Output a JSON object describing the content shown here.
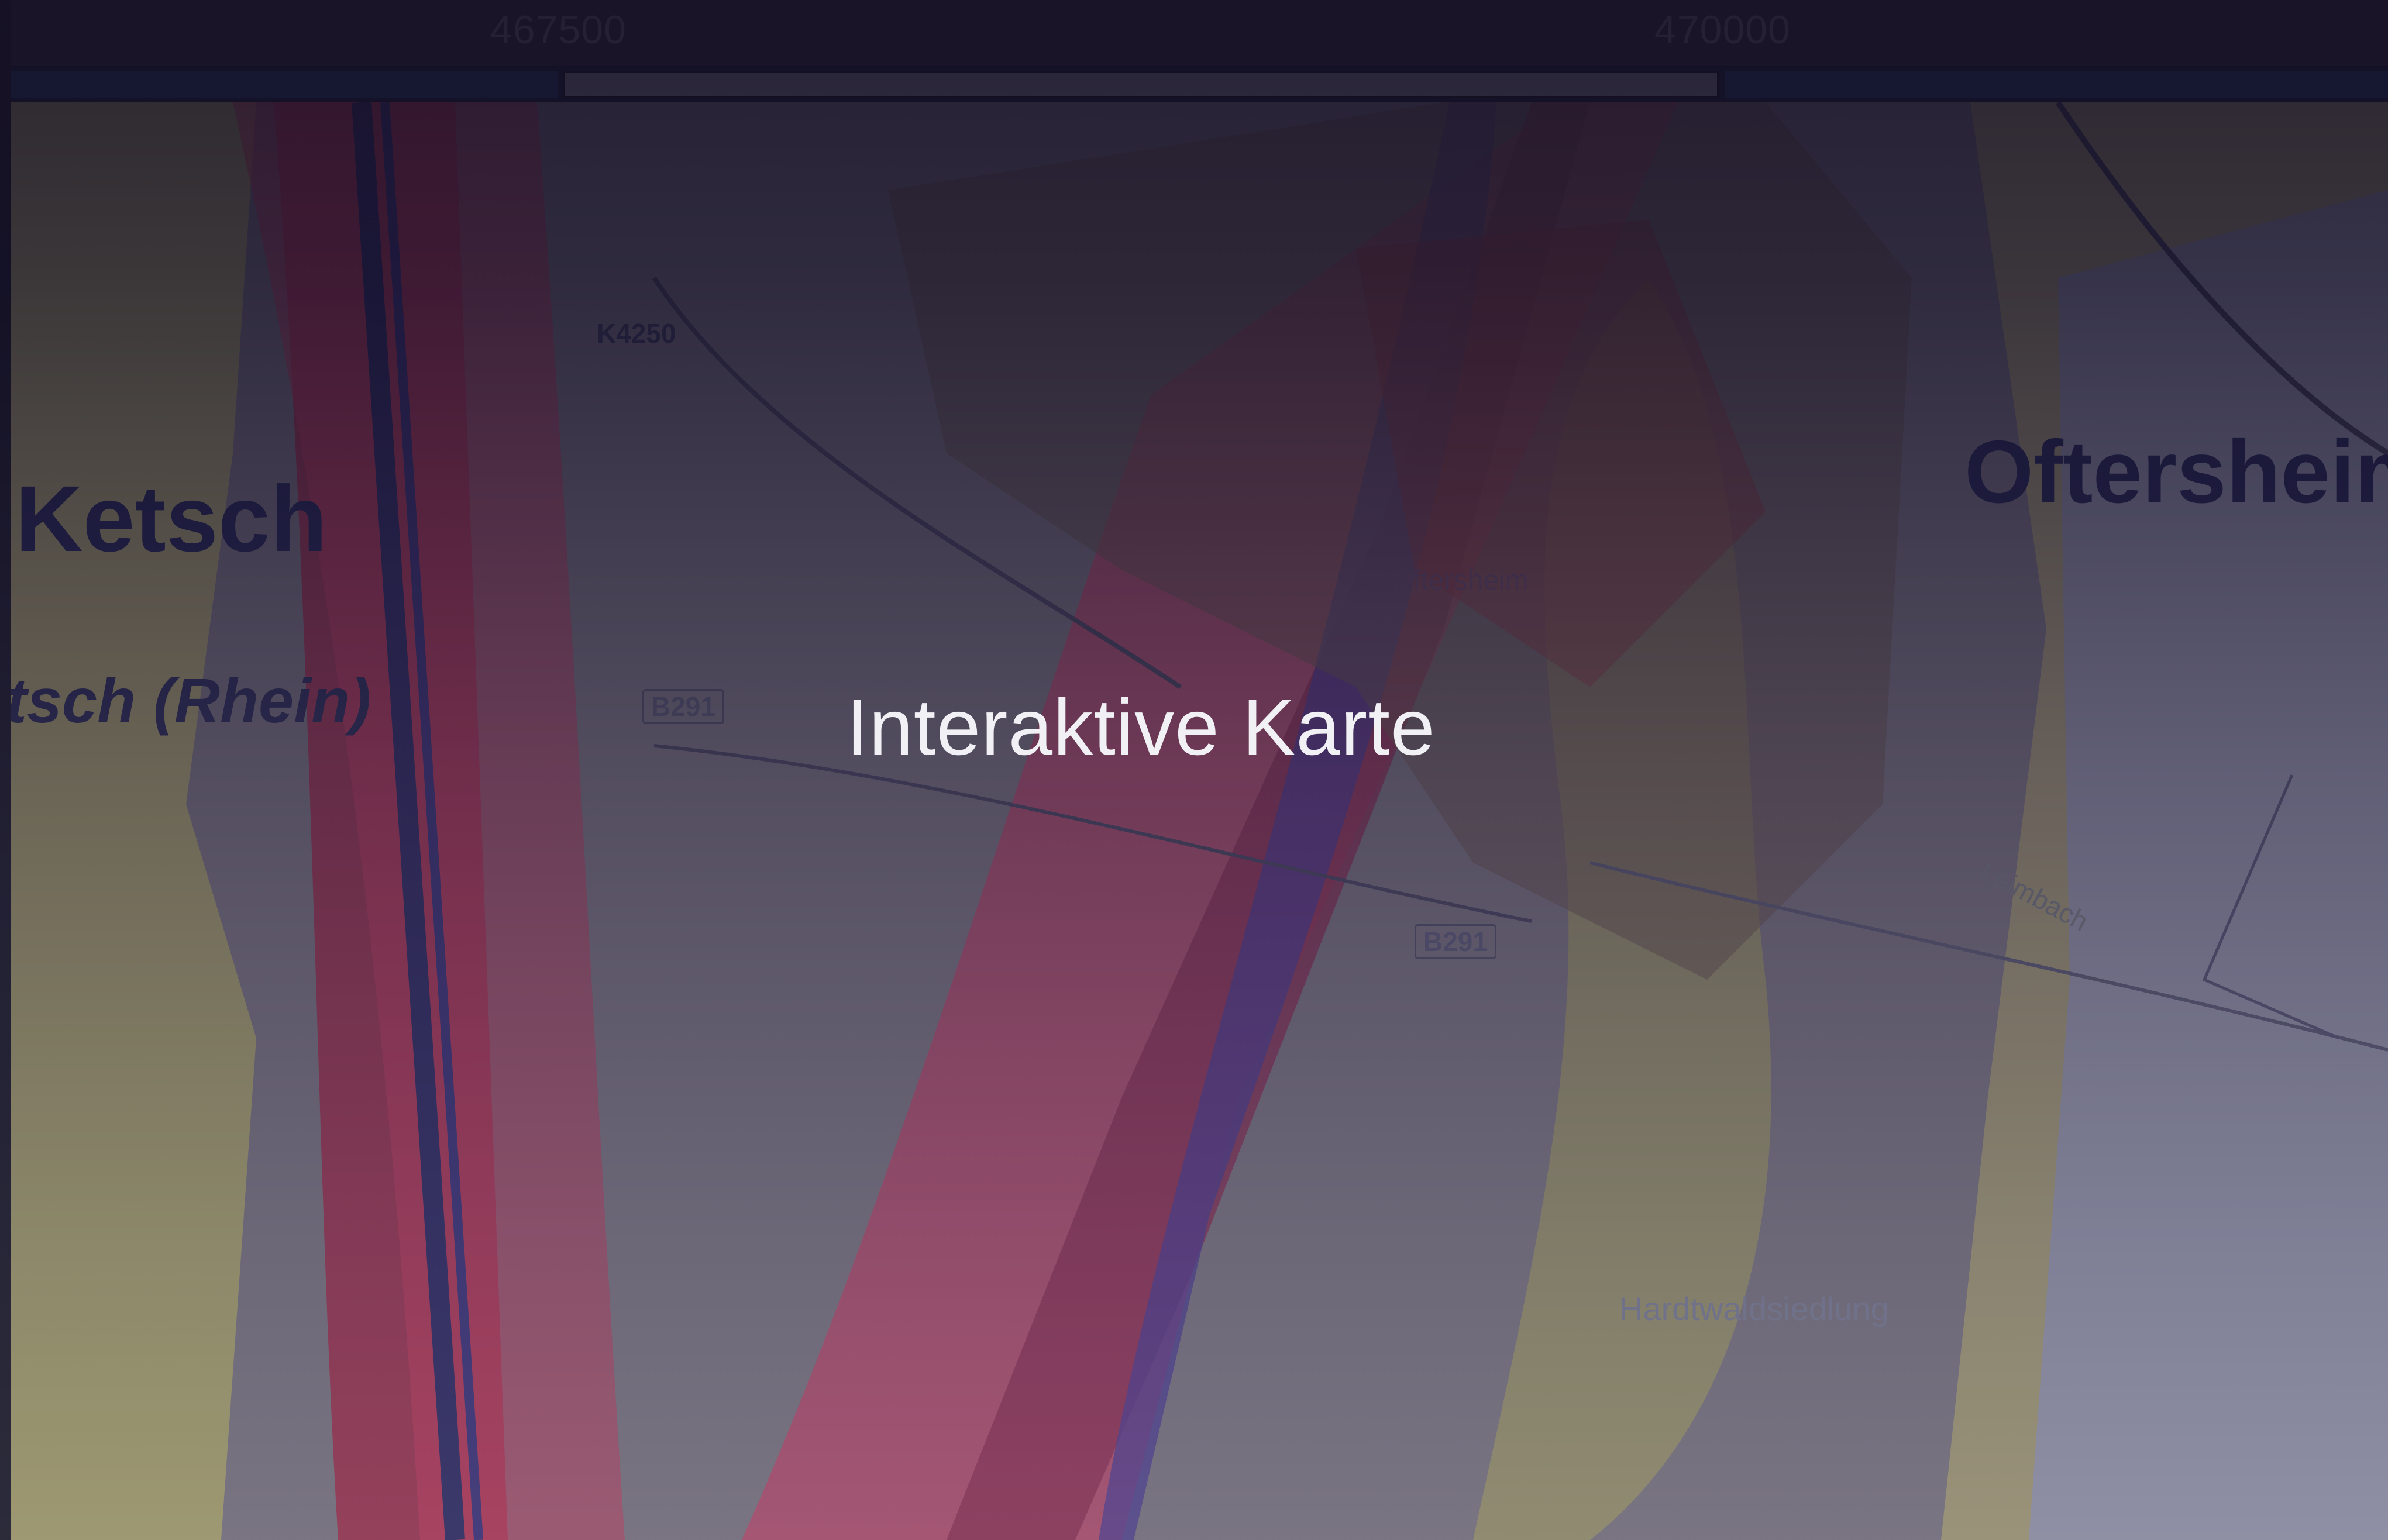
{
  "title": "Interaktive Karte",
  "ruler": {
    "ticks": [
      "467500",
      "470000"
    ]
  },
  "map": {
    "places": {
      "ketsch": "Ketsch",
      "ketsch_rhein": "tsch (Rhein)",
      "oftersheim": "Oftersheim",
      "oftersheim_small": "Oftersheim",
      "hardtwaldsiedlung": "Hardtwaldsiedlung",
      "leimbach": "Leimbach"
    },
    "roads": {
      "k4250": "K4250",
      "b291_a": "B291",
      "b291_b": "B291"
    },
    "colors": {
      "noise_high": "#b3283c",
      "noise_mid": "#d8416a",
      "noise_low": "#e6d85a",
      "overlay_top": "#160f26",
      "overlay_bottom": "#7878b4"
    }
  }
}
